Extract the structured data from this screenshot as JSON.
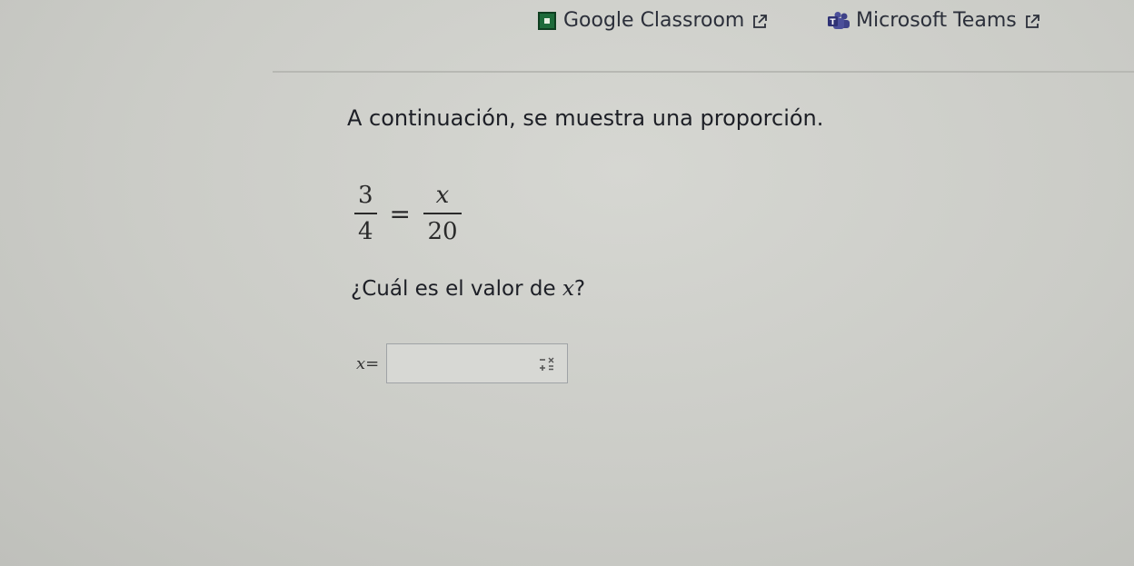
{
  "share": {
    "google_classroom": {
      "label": "Google Classroom",
      "icon": "google-classroom-logo",
      "external_icon": "external-link-icon"
    },
    "microsoft_teams": {
      "label": "Microsoft Teams",
      "icon": "microsoft-teams-logo",
      "external_icon": "external-link-icon"
    }
  },
  "question": {
    "intro": "A continuación, se muestra una proporción.",
    "proportion": {
      "left_numerator": "3",
      "left_denominator": "4",
      "equals": "=",
      "right_numerator": "x",
      "right_denominator": "20"
    },
    "prompt_text": "¿Cuál es el valor de ",
    "prompt_var": "x",
    "prompt_end": "?"
  },
  "answer": {
    "label_var": "x",
    "label_eq": "=",
    "value": "",
    "keypad_icon": "math-keypad-icon"
  },
  "colors": {
    "background": "#cbccc7",
    "text": "#1d1f26",
    "classroom_green": "#1e6b3a",
    "teams_purple": "#4b4f9a",
    "input_border": "#9fa3a6"
  }
}
